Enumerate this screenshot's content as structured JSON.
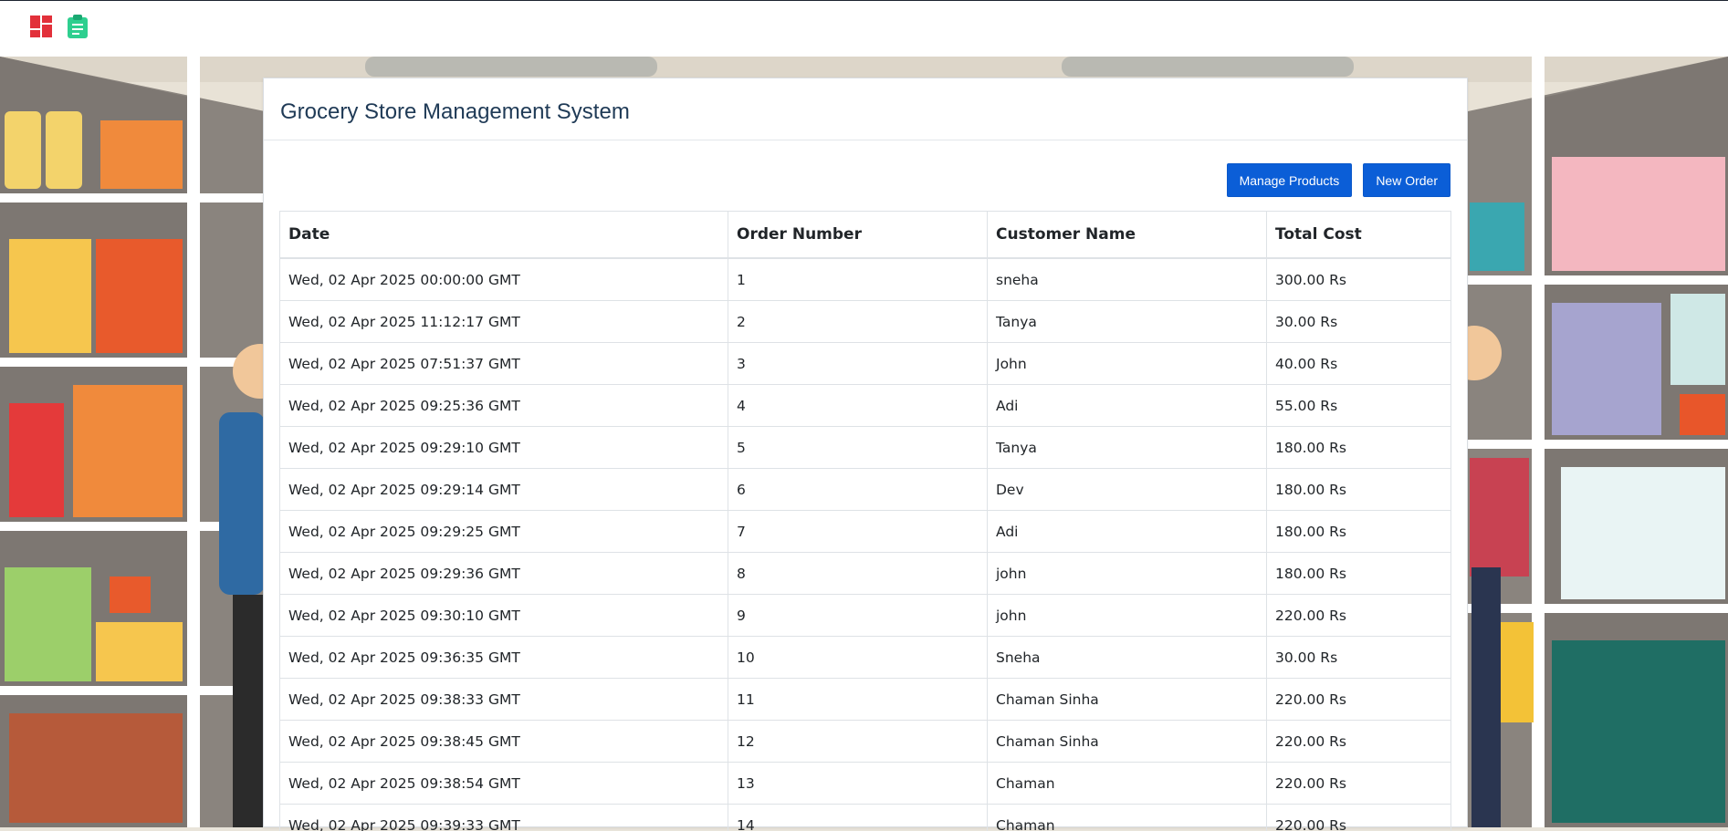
{
  "topbar": {
    "dashboard_icon": "dashboard-grid-icon",
    "orders_icon": "clipboard-icon",
    "accent": "#e2303a",
    "accent2": "#2ecf8f"
  },
  "panel": {
    "title": "Grocery Store Management System"
  },
  "actions": {
    "manage_products": "Manage Products",
    "new_order": "New Order"
  },
  "table": {
    "headers": [
      "Date",
      "Order Number",
      "Customer Name",
      "Total Cost"
    ],
    "rows": [
      [
        "Wed, 02 Apr 2025 00:00:00 GMT",
        "1",
        "sneha",
        "300.00 Rs"
      ],
      [
        "Wed, 02 Apr 2025 11:12:17 GMT",
        "2",
        "Tanya",
        "30.00 Rs"
      ],
      [
        "Wed, 02 Apr 2025 07:51:37 GMT",
        "3",
        "John",
        "40.00 Rs"
      ],
      [
        "Wed, 02 Apr 2025 09:25:36 GMT",
        "4",
        "Adi",
        "55.00 Rs"
      ],
      [
        "Wed, 02 Apr 2025 09:29:10 GMT",
        "5",
        "Tanya",
        "180.00 Rs"
      ],
      [
        "Wed, 02 Apr 2025 09:29:14 GMT",
        "6",
        "Dev",
        "180.00 Rs"
      ],
      [
        "Wed, 02 Apr 2025 09:29:25 GMT",
        "7",
        "Adi",
        "180.00 Rs"
      ],
      [
        "Wed, 02 Apr 2025 09:29:36 GMT",
        "8",
        "john",
        "180.00 Rs"
      ],
      [
        "Wed, 02 Apr 2025 09:30:10 GMT",
        "9",
        "john",
        "220.00 Rs"
      ],
      [
        "Wed, 02 Apr 2025 09:36:35 GMT",
        "10",
        "Sneha",
        "30.00 Rs"
      ],
      [
        "Wed, 02 Apr 2025 09:38:33 GMT",
        "11",
        "Chaman Sinha",
        "220.00 Rs"
      ],
      [
        "Wed, 02 Apr 2025 09:38:45 GMT",
        "12",
        "Chaman Sinha",
        "220.00 Rs"
      ],
      [
        "Wed, 02 Apr 2025 09:38:54 GMT",
        "13",
        "Chaman",
        "220.00 Rs"
      ],
      [
        "Wed, 02 Apr 2025 09:39:33 GMT",
        "14",
        "Chaman",
        "220.00 Rs"
      ]
    ]
  }
}
